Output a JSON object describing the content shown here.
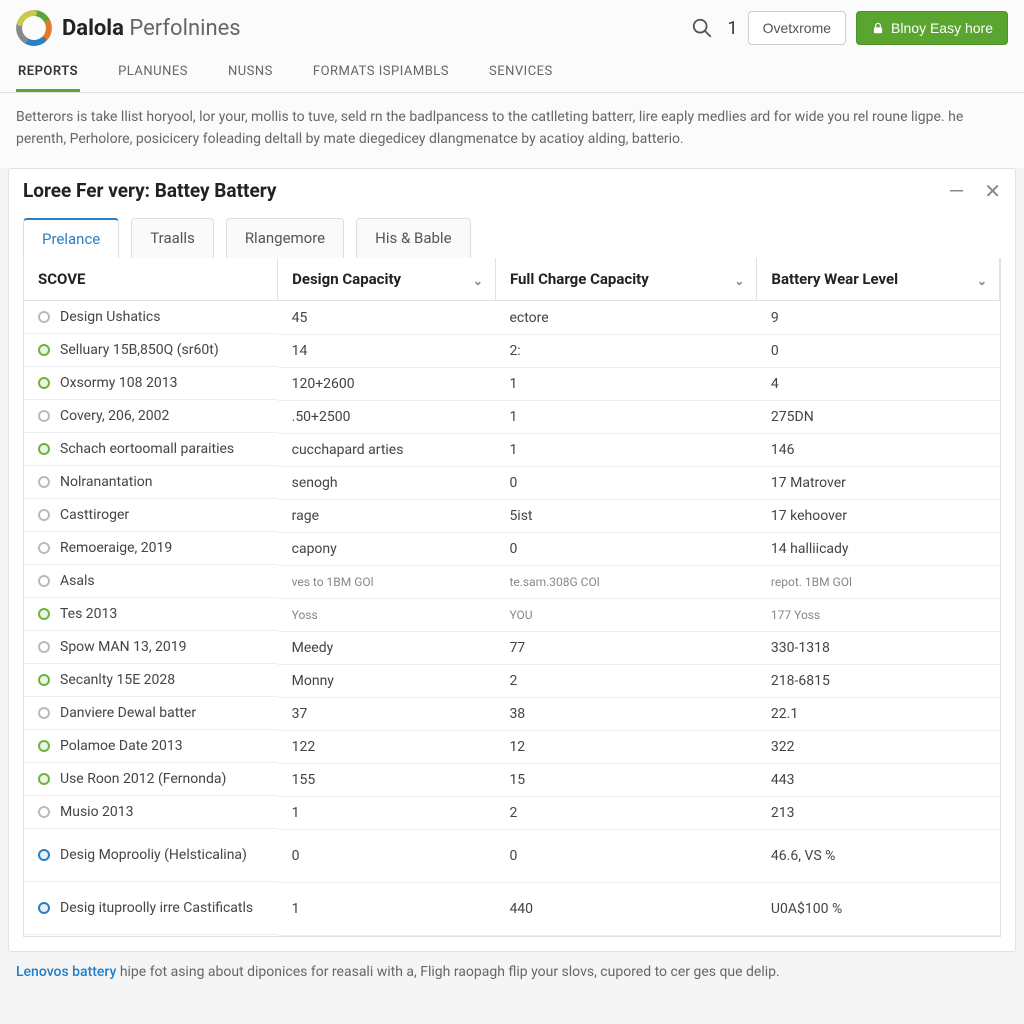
{
  "brand": {
    "bold": "Dalola",
    "light": "Perfolnines"
  },
  "top": {
    "search_count": "1",
    "btn_secondary": "Ovetxrome",
    "btn_primary": "Blnoy Easy hore"
  },
  "nav": {
    "items": [
      "REPORTS",
      "PLANUNES",
      "NUSNS",
      "FORMATS ISPIAMBLS",
      "SENVICES"
    ],
    "active": 0
  },
  "description": "Betterors is take llist horyool, lor your, mollis to tuve, seld rn the badlpancess to the catlleting batterr, lire eaply medlies ard for wide you rel roune ligpe. he perenth, Perholore, posicicery foleading deltall by mate diegedicey dlangmenatce by acatioy alding, batterio.",
  "panel": {
    "title": "Loree Fer very: Battey Battery",
    "tabs": [
      "Prelance",
      "Traalls",
      "Rlangemore",
      "His & Bable"
    ],
    "active_tab": 0,
    "columns": [
      "SCOVE",
      "Design Capacity",
      "Full Charge Capacity",
      "Battery Wear Level"
    ],
    "rows": [
      {
        "b": "gray",
        "c0": "Design Ushatics",
        "c1": "45",
        "c2": "ectore",
        "c3": "9"
      },
      {
        "b": "green",
        "c0": "Selluary 15B,850Q (sr60t)",
        "c1": "14",
        "c2": "2:",
        "c3": "0"
      },
      {
        "b": "green",
        "c0": "Oxsormy 108 2013",
        "c1": "120+2600",
        "c2": "1",
        "c3": "4"
      },
      {
        "b": "gray",
        "c0": "Covery, 206, 2002",
        "c1": ".50+2500",
        "c2": "1",
        "c3": "275DN"
      },
      {
        "b": "green",
        "c0": "Schach eortoomall paraities",
        "c1": "cucchapard arties",
        "c2": "1",
        "c3": "146"
      },
      {
        "b": "gray",
        "c0": "Nolranantation",
        "c1": "senogh",
        "c2": "0",
        "c3": "17 Matrover"
      },
      {
        "b": "gray",
        "c0": "Casttiroger",
        "c1": "rage",
        "c2": "5ist",
        "c3": "17 kehoover"
      },
      {
        "b": "gray",
        "c0": "Remoeraige, 2019",
        "c1": "capony",
        "c2": "0",
        "c3": "14 halliicady"
      },
      {
        "b": "gray",
        "c0": "Asals",
        "c1": "ves to 1BM GOl",
        "c2": "te.sam.308G COl",
        "c3": "repot. 1BM GOl",
        "small": true
      },
      {
        "b": "green",
        "c0": "Tes 2013",
        "c1": "Yoss",
        "c2": "YOU",
        "c3": "177 Yoss",
        "small": true
      },
      {
        "b": "gray",
        "c0": "Spow MAN 13, 2019",
        "c1": "Meedy",
        "c2": "77",
        "c3": "330-1318"
      },
      {
        "b": "green",
        "c0": "Secanlty 15E 2028",
        "c1": "Monny",
        "c2": "2",
        "c3": "218-6815"
      },
      {
        "b": "gray",
        "c0": "Danviere Dewal batter",
        "c1": "37",
        "c2": "38",
        "c3": "22.1"
      },
      {
        "b": "green",
        "c0": "Polamoe Date 2013",
        "c1": "122",
        "c2": "12",
        "c3": "322"
      },
      {
        "b": "green",
        "c0": "Use Roon 2012 (Fernonda)",
        "c1": "155",
        "c2": "15",
        "c3": "443"
      },
      {
        "b": "gray",
        "c0": "Musio 2013",
        "c1": "1",
        "c2": "2",
        "c3": "213"
      }
    ],
    "summary": [
      {
        "b": "blue",
        "c0": "Desig Moprooliy (Helsticalina)",
        "c1": "0",
        "c2": "0",
        "c3": "46.6, VS %"
      },
      {
        "b": "blue",
        "c0": "Desig ituproolly irre Castificatls",
        "c1": "1",
        "c2": "440",
        "c3": "U0A$100 %"
      }
    ]
  },
  "footer": {
    "link": "Lenovos battery",
    "text": " hipe fot asing about diponices for reasali with a, Fligh raopagh flip your slovs, cupored to cer ges que delip."
  }
}
